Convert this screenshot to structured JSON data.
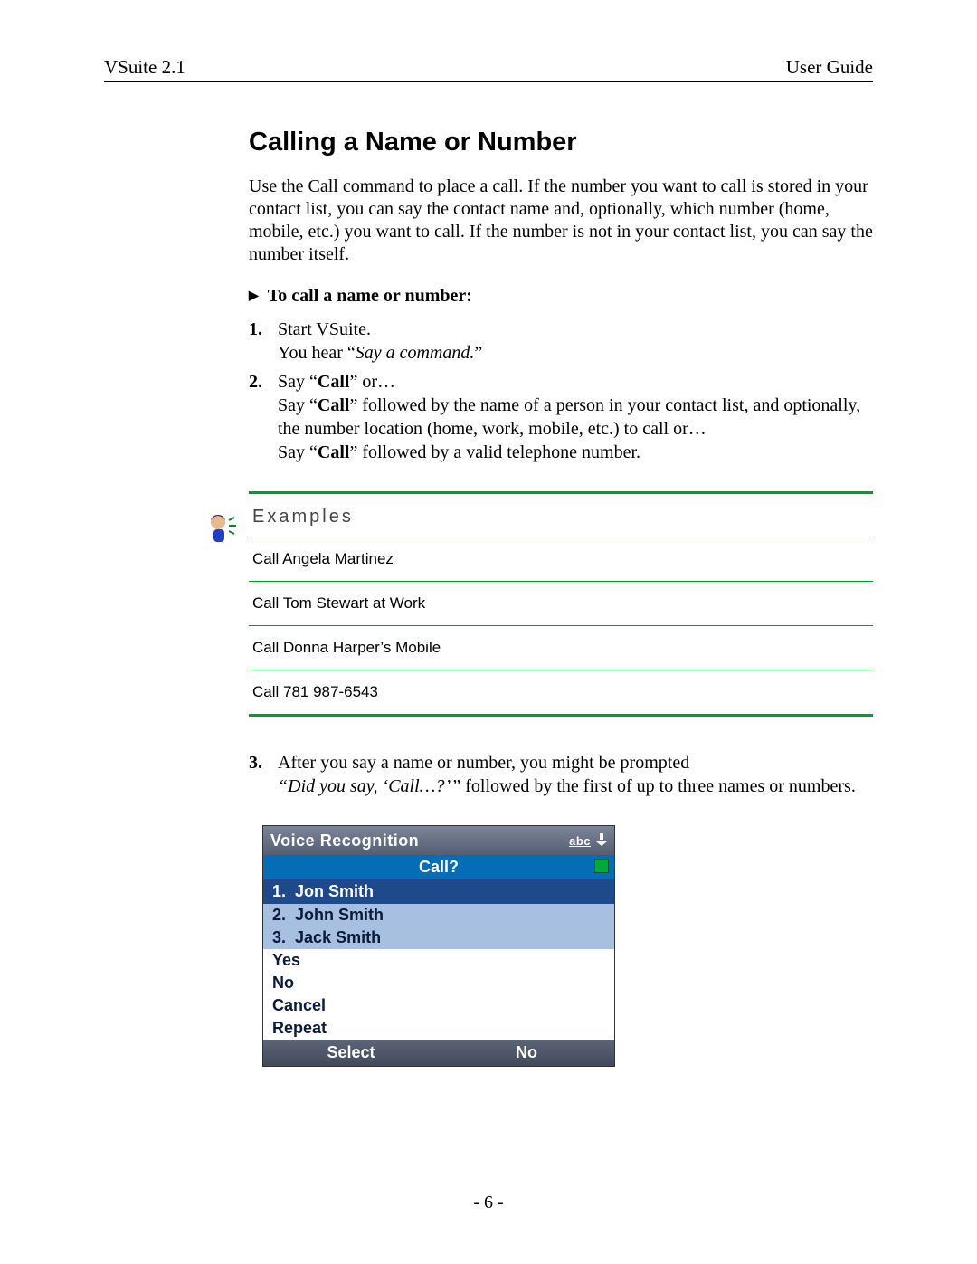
{
  "header": {
    "left": "VSuite 2.1",
    "right": "User Guide"
  },
  "title": "Calling a Name or Number",
  "intro": "Use the Call command to place a call. If the number you want to call is stored in your contact list, you can say the contact name and, optionally, which number (home, mobile, etc.) you want to call. If the number is not in your contact list, you can say the number itself.",
  "procedure_heading": "To call a name or number:",
  "steps12": {
    "s1": {
      "num": "1.",
      "line1": "Start VSuite.",
      "line2_a": "You hear “",
      "line2_b_italic": "Say a command.",
      "line2_c": "”"
    },
    "s2": {
      "num": "2.",
      "l1_a": "Say “",
      "l1_b_bold": "Call",
      "l1_c": "” or…",
      "l2_a": "Say “",
      "l2_b_bold": "Call",
      "l2_c": "” followed by the name of a person in your contact list, and optionally, the number location (home, work, mobile, etc.) to call or…",
      "l3_a": "Say “",
      "l3_b_bold": "Call",
      "l3_c": "” followed by a valid telephone number."
    }
  },
  "examples": {
    "title": "Examples",
    "items": [
      "Call Angela Martinez",
      "Call Tom Stewart at Work",
      "Call Donna Harper’s Mobile",
      "Call 781 987-6543"
    ]
  },
  "step3": {
    "num": "3.",
    "l1": "After you say a name or number, you might be prompted",
    "l2_italic": "“Did you say, ‘Call…?’”",
    "l2_rest": " followed by the first of up to three names or numbers."
  },
  "phone": {
    "title": "Voice Recognition",
    "abc": "abc",
    "prompt": "Call?",
    "candidates": [
      {
        "n": "1.",
        "name": "Jon Smith"
      },
      {
        "n": "2.",
        "name": "John Smith"
      },
      {
        "n": "3.",
        "name": "Jack Smith"
      }
    ],
    "options": [
      "Yes",
      "No",
      "Cancel",
      "Repeat"
    ],
    "softkeys": {
      "left": "Select",
      "right": "No"
    }
  },
  "page_number": "- 6 -"
}
